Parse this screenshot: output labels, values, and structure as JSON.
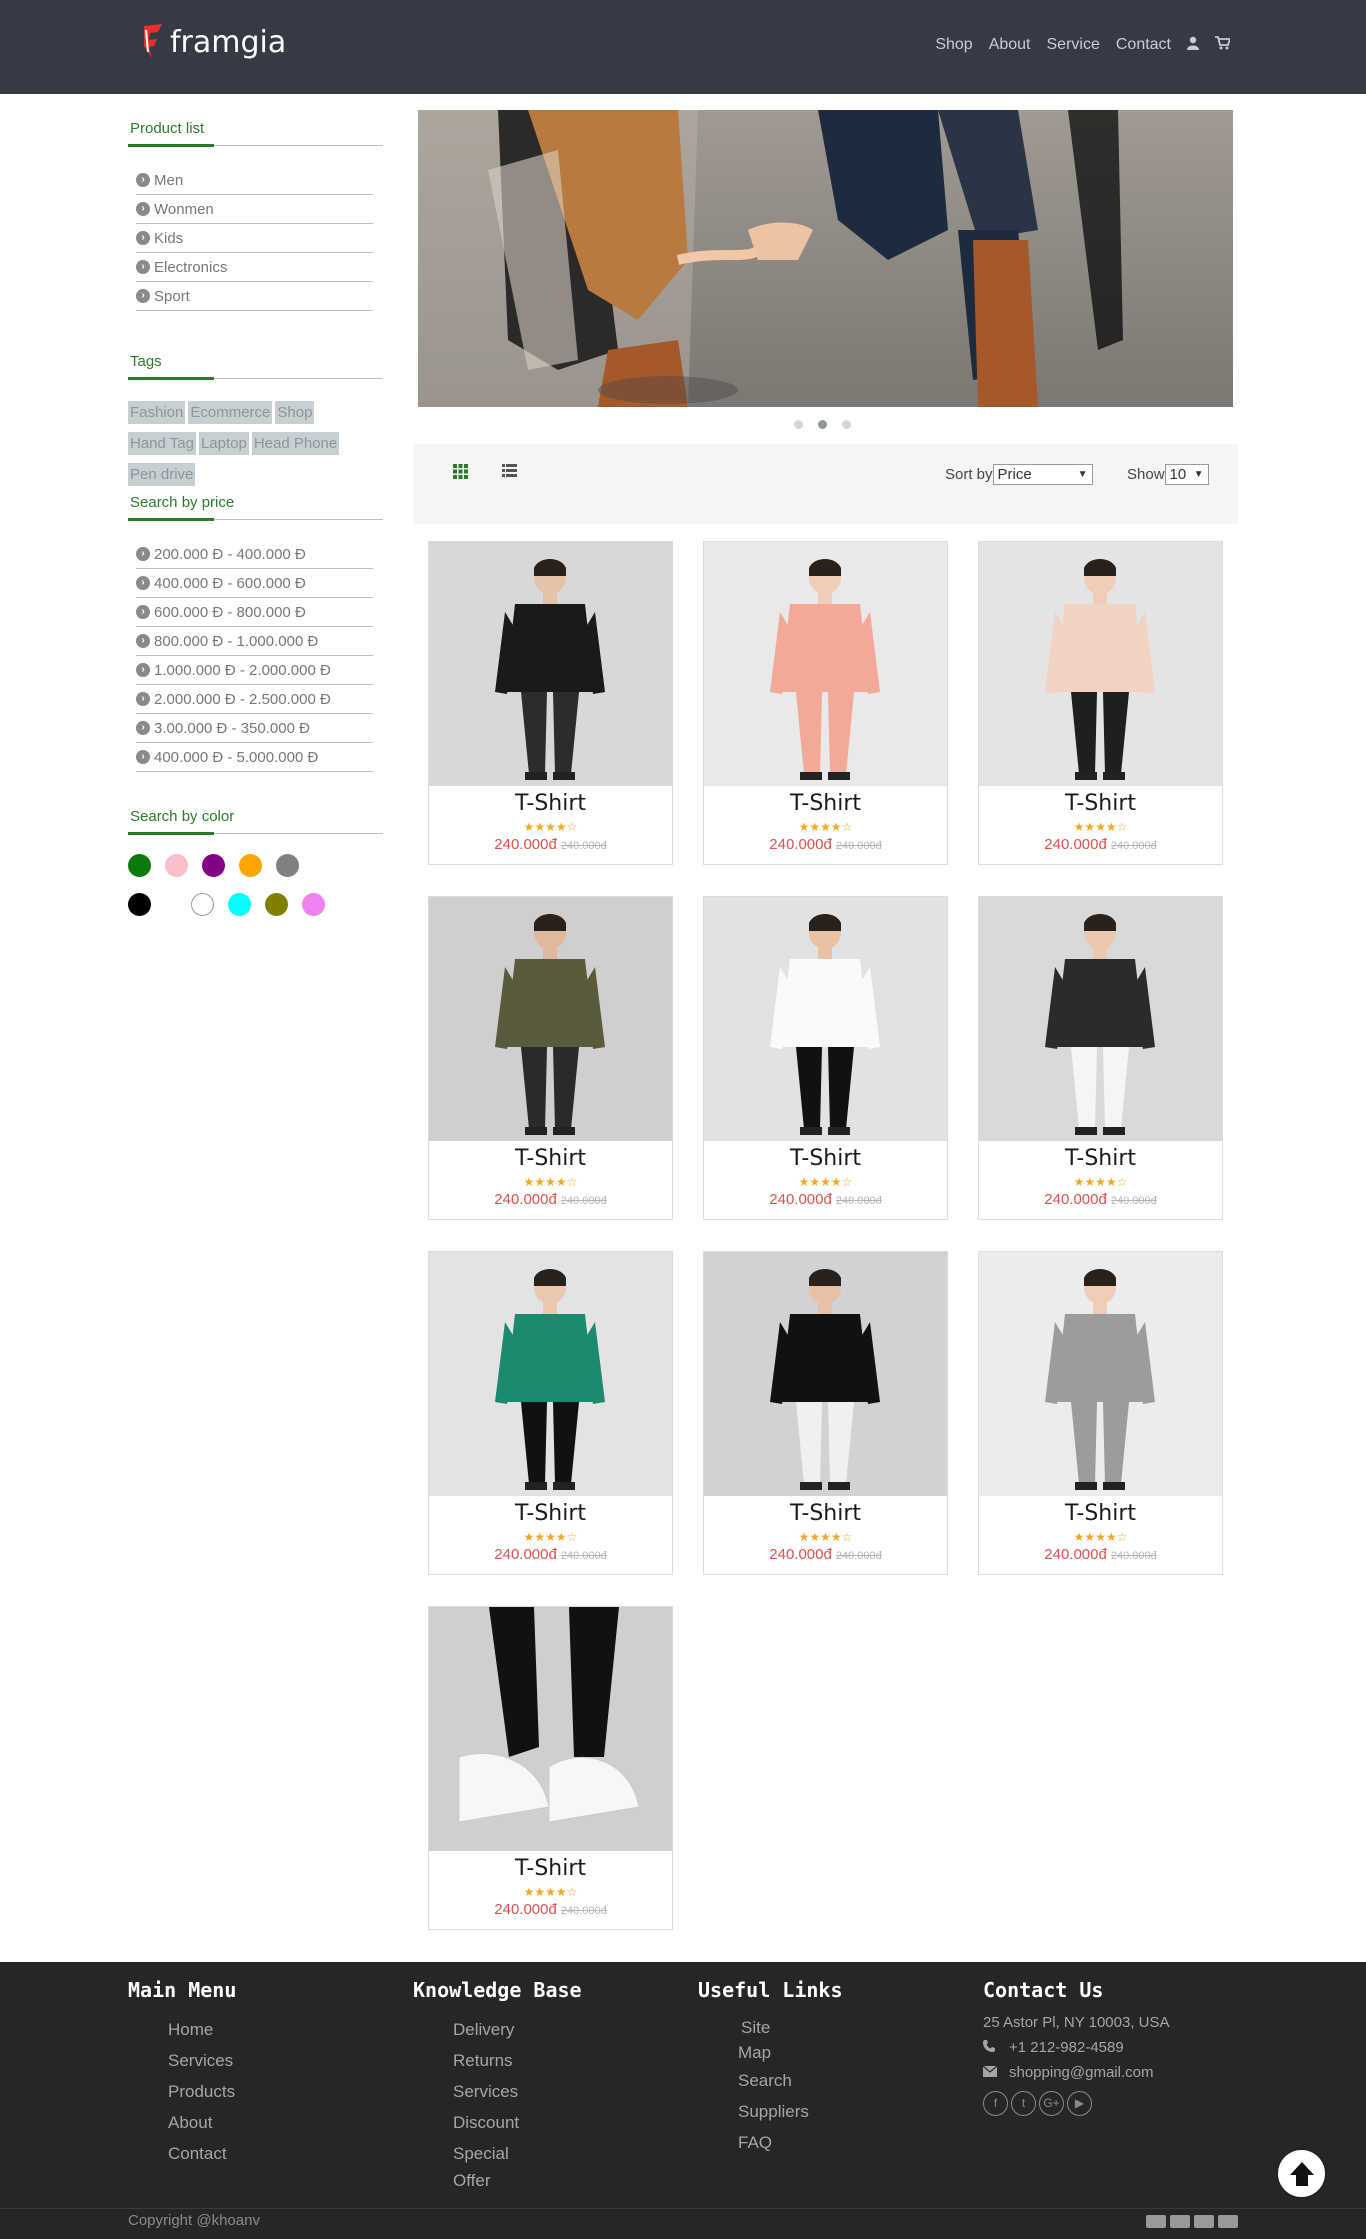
{
  "header": {
    "logo_text": "framgia",
    "nav": [
      "Shop",
      "About",
      "Service",
      "Contact"
    ],
    "icons": [
      "user-icon",
      "cart-icon"
    ]
  },
  "sidebar": {
    "product_list": {
      "title": "Product list",
      "items": [
        "Men",
        "Wonmen",
        "Kids",
        "Electronics",
        "Sport"
      ]
    },
    "tags": {
      "title": "Tags",
      "items": [
        "Fashion",
        "Ecommerce",
        "Shop",
        "Hand Tag",
        "Laptop",
        "Head Phone",
        "Pen drive"
      ]
    },
    "price": {
      "title": "Search by price",
      "items": [
        "200.000 Đ - 400.000 Đ",
        "400.000 Đ - 600.000 Đ",
        "600.000 Đ - 800.000 Đ",
        "800.000 Đ - 1.000.000 Đ",
        "1.000.000 Đ - 2.000.000 Đ",
        "2.000.000 Đ - 2.500.000 Đ",
        "3.00.000 Đ - 350.000 Đ",
        "400.000 Đ - 5.000.000 Đ"
      ]
    },
    "color": {
      "title": "Search by color",
      "swatches": [
        "#0a7a0a",
        "#f7c0cb",
        "#850085",
        "#ffa500",
        "#808080",
        "#000000",
        "#ffffff",
        "#00ffff",
        "#808000",
        "#ee82ee"
      ]
    }
  },
  "carousel": {
    "slides": 3,
    "active": 1
  },
  "toolbar": {
    "sort_label": "Sort by",
    "sort_value": "Price",
    "show_label": "Show",
    "show_value": "10"
  },
  "products": [
    {
      "name": "T-Shirt",
      "rating": 4,
      "price": "240.000đ",
      "old_price": "240.000đ"
    },
    {
      "name": "T-Shirt",
      "rating": 4,
      "price": "240.000đ",
      "old_price": "240.000đ"
    },
    {
      "name": "T-Shirt",
      "rating": 4,
      "price": "240.000đ",
      "old_price": "240.000đ"
    },
    {
      "name": "T-Shirt",
      "rating": 4,
      "price": "240.000đ",
      "old_price": "240.000đ"
    },
    {
      "name": "T-Shirt",
      "rating": 4,
      "price": "240.000đ",
      "old_price": "240.000đ"
    },
    {
      "name": "T-Shirt",
      "rating": 4,
      "price": "240.000đ",
      "old_price": "240.000đ"
    },
    {
      "name": "T-Shirt",
      "rating": 4,
      "price": "240.000đ",
      "old_price": "240.000đ"
    },
    {
      "name": "T-Shirt",
      "rating": 4,
      "price": "240.000đ",
      "old_price": "240.000đ"
    },
    {
      "name": "T-Shirt",
      "rating": 4,
      "price": "240.000đ",
      "old_price": "240.000đ"
    },
    {
      "name": "T-Shirt",
      "rating": 4,
      "price": "240.000đ",
      "old_price": "240.000đ"
    }
  ],
  "footer": {
    "main_menu": {
      "title": "Main Menu",
      "items": [
        "Home",
        "Services",
        "Products",
        "About",
        "Contact"
      ]
    },
    "knowledge": {
      "title": "Knowledge Base",
      "items": [
        "Delivery",
        "Returns",
        "Services",
        "Discount",
        "Special",
        "Offer"
      ]
    },
    "useful": {
      "title": "Useful Links",
      "items": [
        "Site",
        "Map",
        "Search",
        "Suppliers",
        "FAQ"
      ]
    },
    "contact": {
      "title": "Contact Us",
      "address": "25 Astor Pl, NY 10003, USA",
      "phone": "+1 212-982-4589",
      "email": "shopping@gmail.com"
    },
    "copyright": "Copyright @khoanv"
  }
}
